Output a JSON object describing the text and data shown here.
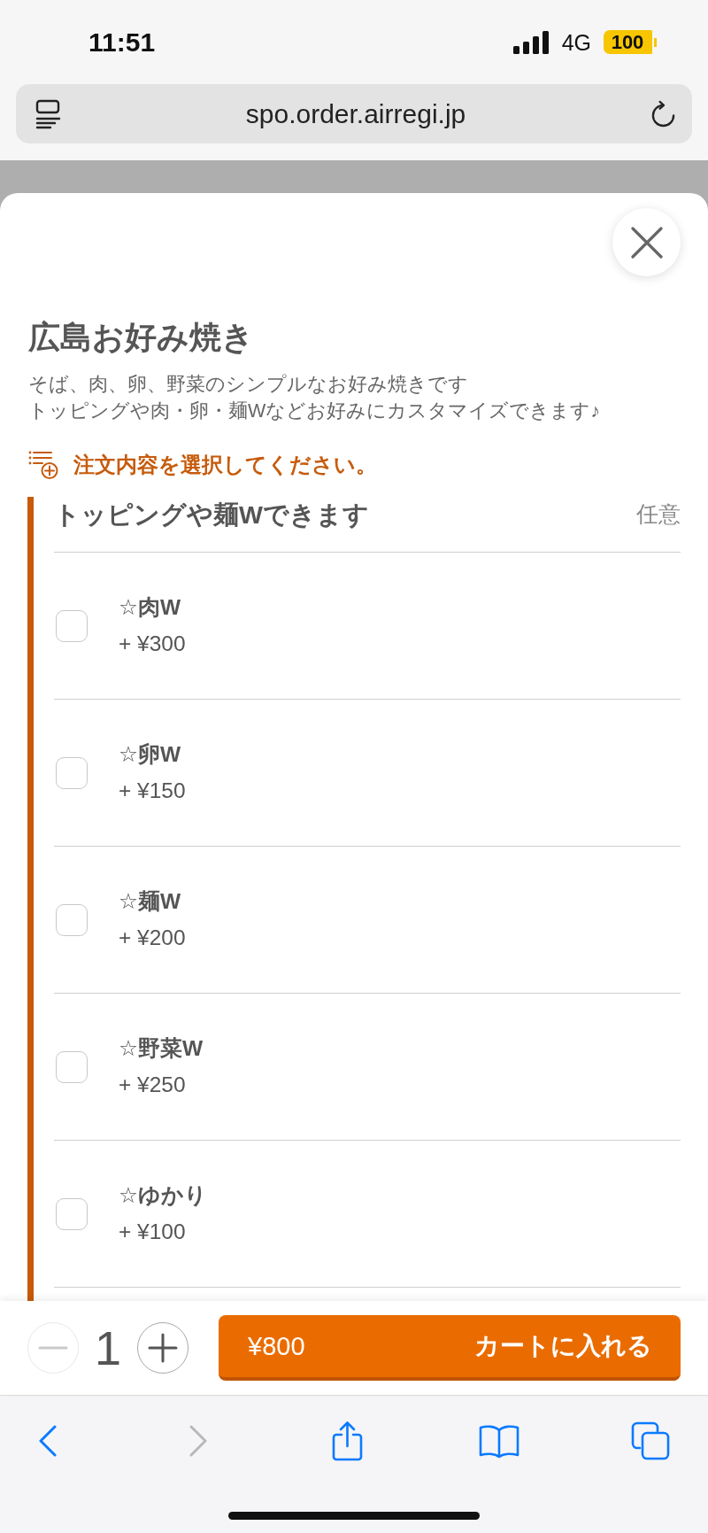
{
  "status_bar": {
    "time": "11:51",
    "network": "4G",
    "battery": "100",
    "low_power": true
  },
  "address_bar": {
    "url": "spo.order.airregi.jp"
  },
  "product": {
    "title": "広島お好み焼き",
    "description": [
      "そば、肉、卵、野菜のシンプルなお好み焼きです",
      "トッピングや肉・卵・麺Wなどお好みにカスタマイズできます♪"
    ]
  },
  "notice": "注文内容を選択してください。",
  "option_group": {
    "title": "トッピングや麺Wできます",
    "requirement": "任意",
    "options": [
      {
        "name": "☆肉W",
        "price": "+ ¥300",
        "checked": false
      },
      {
        "name": "☆卵W",
        "price": "+ ¥150",
        "checked": false
      },
      {
        "name": "☆麺W",
        "price": "+ ¥200",
        "checked": false
      },
      {
        "name": "☆野菜W",
        "price": "+ ¥250",
        "checked": false
      },
      {
        "name": "☆ゆかり",
        "price": "+ ¥100",
        "checked": false
      }
    ]
  },
  "quantity": {
    "value": "1",
    "decrease_disabled": true,
    "increase_disabled": false
  },
  "cart_button": {
    "price": "¥800",
    "label": "カートに入れる"
  },
  "toolbar": [
    {
      "kind": "back",
      "disabled": false
    },
    {
      "kind": "forward",
      "disabled": true
    },
    {
      "kind": "share",
      "disabled": false
    },
    {
      "kind": "bookmarks",
      "disabled": false
    },
    {
      "kind": "tabs",
      "disabled": false
    }
  ]
}
